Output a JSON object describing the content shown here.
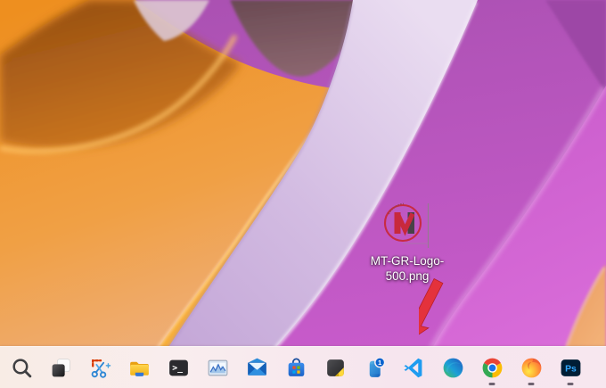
{
  "desktop": {
    "file_icon": {
      "label_line1": "MT-GR-Logo-",
      "label_line2": "500.png",
      "logo_letter": "M",
      "logo_red": "#c8293c",
      "logo_dark": "#474247"
    },
    "annotation": {
      "shape": "arrow",
      "color": "#e4323c"
    }
  },
  "taskbar": {
    "background": "#f7e9ee",
    "running_indicator_color": "#6e6270",
    "items": [
      {
        "id": "search",
        "name": "Search",
        "icon": "search"
      },
      {
        "id": "task-view",
        "name": "Task View",
        "icon": "task-view"
      },
      {
        "id": "snipping-tool",
        "name": "Snipping Tool",
        "icon": "snipping-tool"
      },
      {
        "id": "file-explorer",
        "name": "File Explorer",
        "icon": "file-explorer"
      },
      {
        "id": "terminal",
        "name": "Terminal",
        "icon": "terminal",
        "glyph": ">_"
      },
      {
        "id": "task-manager",
        "name": "Task Manager",
        "icon": "task-manager"
      },
      {
        "id": "mail",
        "name": "Mail",
        "icon": "mail"
      },
      {
        "id": "microsoft-store",
        "name": "Microsoft Store",
        "icon": "microsoft-store"
      },
      {
        "id": "sticky-notes",
        "name": "Sticky Notes",
        "icon": "sticky-notes"
      },
      {
        "id": "phone-link",
        "name": "Phone Link",
        "icon": "phone-link",
        "badge": "1"
      },
      {
        "id": "vscode",
        "name": "Visual Studio Code",
        "icon": "vscode"
      },
      {
        "id": "edge",
        "name": "Microsoft Edge",
        "icon": "edge"
      },
      {
        "id": "chrome",
        "name": "Google Chrome",
        "icon": "chrome",
        "running": true
      },
      {
        "id": "firefox",
        "name": "Firefox",
        "icon": "firefox",
        "running": true
      },
      {
        "id": "photoshop",
        "name": "Adobe Photoshop",
        "icon": "photoshop",
        "glyph": "Ps",
        "running": true
      }
    ]
  },
  "colors": {
    "wallpaper_orange": "#ee8f1f",
    "wallpaper_peach": "#eeb183",
    "wallpaper_orange_shadow": "#8a4610",
    "wallpaper_lavender": "#d6c2e6",
    "wallpaper_magenta": "#cb5ecf",
    "wallpaper_orchid": "#a850b0",
    "wallpaper_mauve": "#6a4a53",
    "badge_blue": "#0b63ce"
  }
}
